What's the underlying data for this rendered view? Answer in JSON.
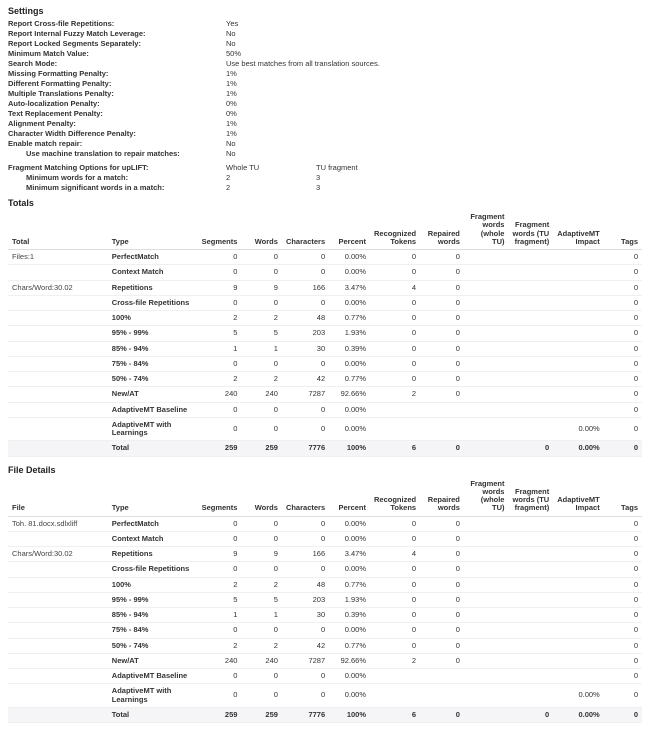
{
  "sections": {
    "settings": "Settings",
    "totals": "Totals",
    "fileDetails": "File Details"
  },
  "settings": [
    {
      "label": "Report Cross-file Repetitions:",
      "value": "Yes"
    },
    {
      "label": "Report Internal Fuzzy Match Leverage:",
      "value": "No"
    },
    {
      "label": "Report Locked Segments Separately:",
      "value": "No"
    },
    {
      "label": "Minimum Match Value:",
      "value": "50%"
    },
    {
      "label": "Search Mode:",
      "value": "Use best matches from all translation sources."
    },
    {
      "label": "Missing Formatting Penalty:",
      "value": "1%"
    },
    {
      "label": "Different Formatting Penalty:",
      "value": "1%"
    },
    {
      "label": "Multiple Translations Penalty:",
      "value": "1%"
    },
    {
      "label": "Auto-localization Penalty:",
      "value": "0%"
    },
    {
      "label": "Text Replacement Penalty:",
      "value": "0%"
    },
    {
      "label": "Alignment Penalty:",
      "value": "1%"
    },
    {
      "label": "Character Width Difference Penalty:",
      "value": "1%"
    },
    {
      "label": "Enable match repair:",
      "value": "No"
    },
    {
      "label": "Use machine translation to repair matches:",
      "value": "No",
      "indent": true
    }
  ],
  "uplift": {
    "title": "Fragment Matching Options for upLIFT:",
    "col1": "Whole TU",
    "col2": "TU fragment",
    "rows": [
      {
        "label": "Minimum words for a match:",
        "c1": "2",
        "c2": "3"
      },
      {
        "label": "Minimum significant words in a match:",
        "c1": "2",
        "c2": "3"
      }
    ]
  },
  "columns": {
    "file": "File",
    "total": "Total",
    "type": "Type",
    "segments": "Segments",
    "words": "Words",
    "characters": "Characters",
    "percent": "Percent",
    "recognizedTokens": "Recognized Tokens",
    "repairedWords": "Repaired words",
    "fragWhole": "Fragment words (whole TU)",
    "fragFrag": "Fragment words (TU fragment)",
    "adaptive": "AdaptiveMT Impact",
    "tags": "Tags"
  },
  "totalsInfo": {
    "line1": "Files:1",
    "line2": "Chars/Word:30.02"
  },
  "fileInfo": {
    "line1": "Toh. 81.docx.sdlxliff",
    "line2": "Chars/Word:30.02"
  },
  "rows": [
    {
      "type": "PerfectMatch",
      "seg": "0",
      "words": "0",
      "chars": "0",
      "pct": "0.00%",
      "tok": "0",
      "rep": "0",
      "fw": "",
      "ff": "",
      "adp": "",
      "tags": "0"
    },
    {
      "type": "Context Match",
      "seg": "0",
      "words": "0",
      "chars": "0",
      "pct": "0.00%",
      "tok": "0",
      "rep": "0",
      "fw": "",
      "ff": "",
      "adp": "",
      "tags": "0"
    },
    {
      "type": "Repetitions",
      "seg": "9",
      "words": "9",
      "chars": "166",
      "pct": "3.47%",
      "tok": "4",
      "rep": "0",
      "fw": "",
      "ff": "",
      "adp": "",
      "tags": "0"
    },
    {
      "type": "Cross-file Repetitions",
      "seg": "0",
      "words": "0",
      "chars": "0",
      "pct": "0.00%",
      "tok": "0",
      "rep": "0",
      "fw": "",
      "ff": "",
      "adp": "",
      "tags": "0"
    },
    {
      "type": "100%",
      "seg": "2",
      "words": "2",
      "chars": "48",
      "pct": "0.77%",
      "tok": "0",
      "rep": "0",
      "fw": "",
      "ff": "",
      "adp": "",
      "tags": "0"
    },
    {
      "type": "95% - 99%",
      "seg": "5",
      "words": "5",
      "chars": "203",
      "pct": "1.93%",
      "tok": "0",
      "rep": "0",
      "fw": "",
      "ff": "",
      "adp": "",
      "tags": "0"
    },
    {
      "type": "85% - 94%",
      "seg": "1",
      "words": "1",
      "chars": "30",
      "pct": "0.39%",
      "tok": "0",
      "rep": "0",
      "fw": "",
      "ff": "",
      "adp": "",
      "tags": "0"
    },
    {
      "type": "75% - 84%",
      "seg": "0",
      "words": "0",
      "chars": "0",
      "pct": "0.00%",
      "tok": "0",
      "rep": "0",
      "fw": "",
      "ff": "",
      "adp": "",
      "tags": "0"
    },
    {
      "type": "50% - 74%",
      "seg": "2",
      "words": "2",
      "chars": "42",
      "pct": "0.77%",
      "tok": "0",
      "rep": "0",
      "fw": "",
      "ff": "",
      "adp": "",
      "tags": "0"
    },
    {
      "type": "New/AT",
      "seg": "240",
      "words": "240",
      "chars": "7287",
      "pct": "92.66%",
      "tok": "2",
      "rep": "0",
      "fw": "",
      "ff": "",
      "adp": "",
      "tags": "0"
    },
    {
      "type": "AdaptiveMT Baseline",
      "seg": "0",
      "words": "0",
      "chars": "0",
      "pct": "0.00%",
      "tok": "",
      "rep": "",
      "fw": "",
      "ff": "",
      "adp": "",
      "tags": "0"
    },
    {
      "type": "AdaptiveMT with Learnings",
      "seg": "0",
      "words": "0",
      "chars": "0",
      "pct": "0.00%",
      "tok": "",
      "rep": "",
      "fw": "",
      "ff": "",
      "adp": "0.00%",
      "tags": "0"
    },
    {
      "type": "Total",
      "seg": "259",
      "words": "259",
      "chars": "7776",
      "pct": "100%",
      "tok": "6",
      "rep": "0",
      "fw": "",
      "ff": "0",
      "adp": "0.00%",
      "tags": "0",
      "total": true
    }
  ]
}
